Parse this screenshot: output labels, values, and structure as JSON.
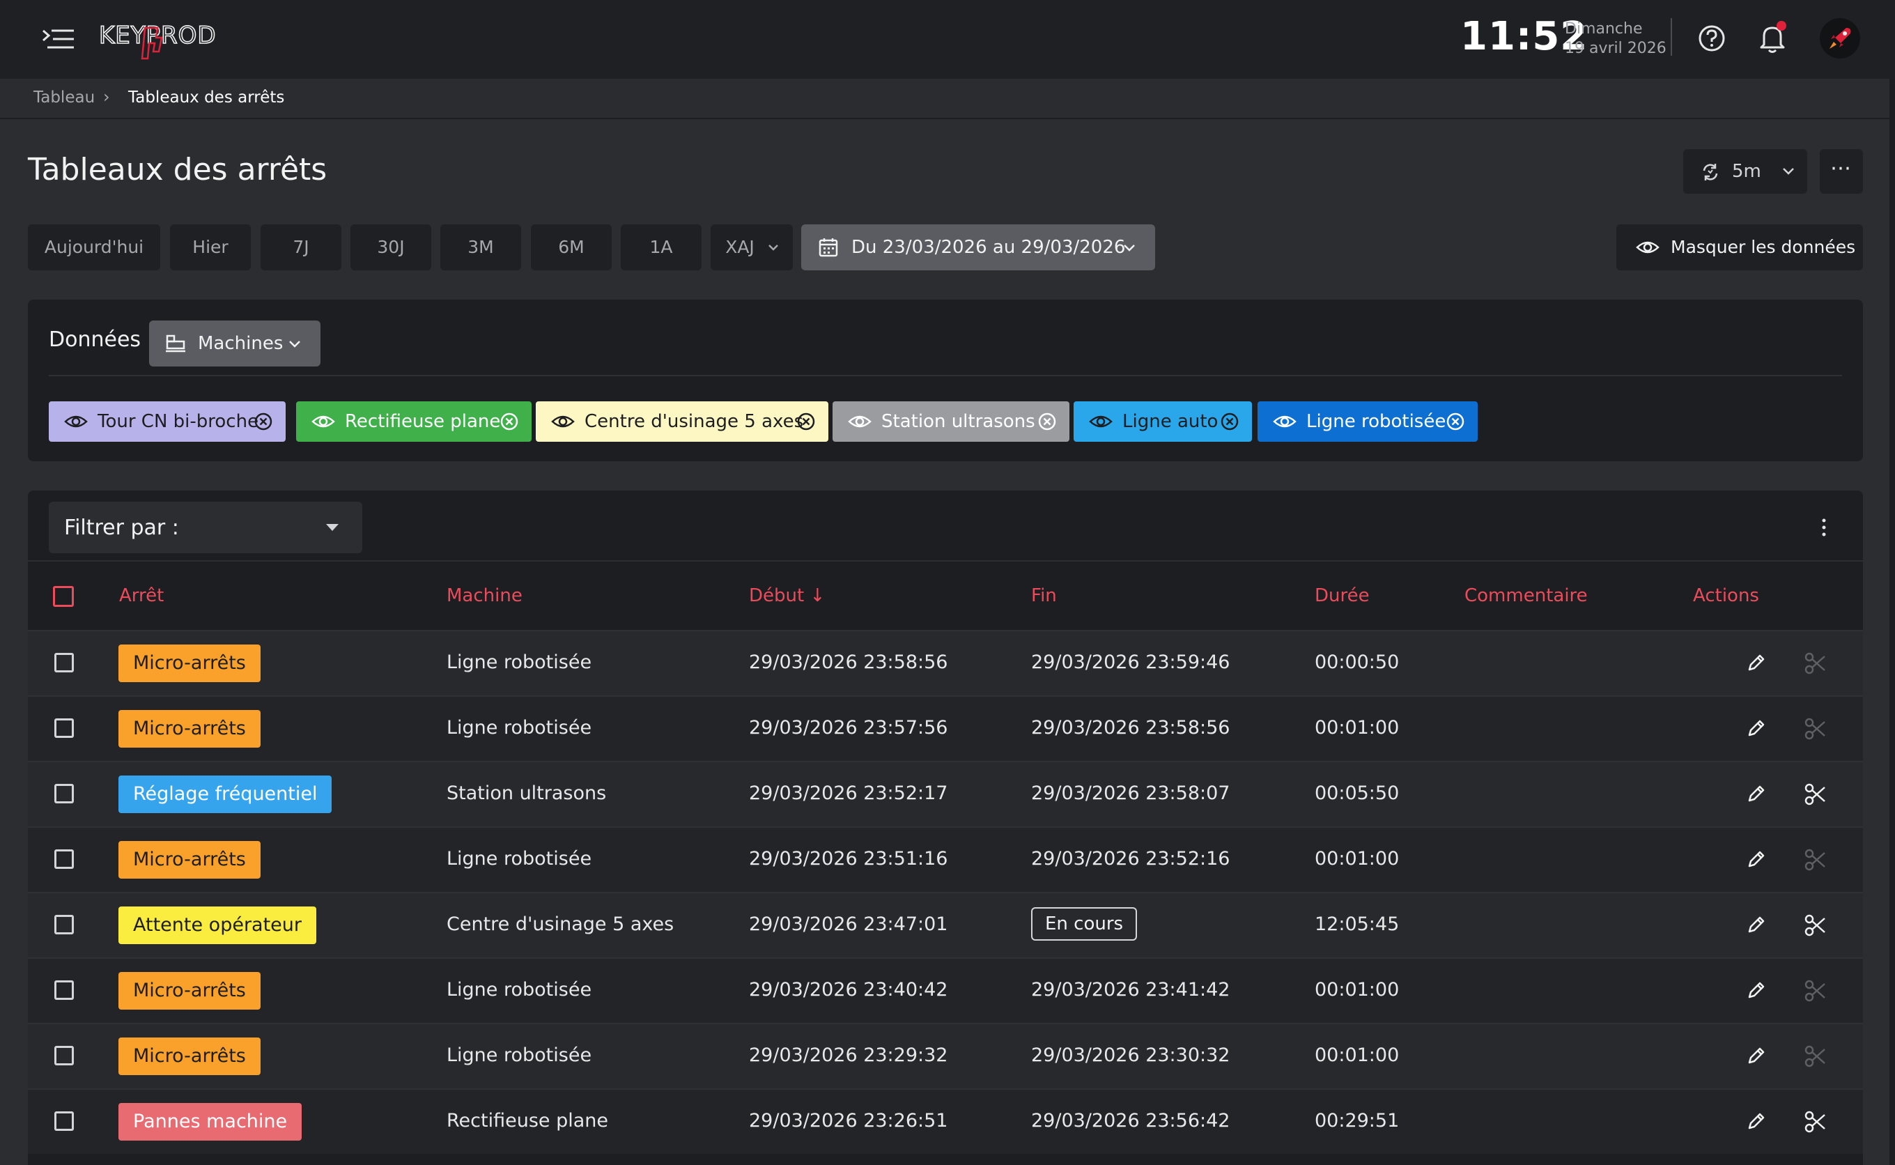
{
  "header": {
    "logo_text": "KEYPROD",
    "time": "11:52",
    "day": "Dimanche",
    "date": "19 avril 2026"
  },
  "breadcrumb": {
    "home": "Tableau",
    "separator": "›",
    "current": "Tableaux des arrêts"
  },
  "page": {
    "title": "Tableaux des arrêts",
    "refresh_label": "5m",
    "more_label": "⋯"
  },
  "period": {
    "buttons": [
      "Aujourd'hui",
      "Hier",
      "7J",
      "30J",
      "3M",
      "6M",
      "1A",
      "XAJ"
    ],
    "range_label": "Du 23/03/2026 au 29/03/2026",
    "hide_label": "Masquer les données"
  },
  "data_panel": {
    "label": "Données",
    "source_label": "Machines",
    "tags": [
      {
        "label": "Tour CN bi-broche",
        "bg": "#b7b3ea",
        "fg": "#1d1e21"
      },
      {
        "label": "Rectifieuse plane",
        "bg": "#3fb04a",
        "fg": "#ffffff"
      },
      {
        "label": "Centre d'usinage 5 axes",
        "bg": "#fdf7c4",
        "fg": "#1d1e21"
      },
      {
        "label": "Station ultrasons",
        "bg": "#9b9ca0",
        "fg": "#ffffff"
      },
      {
        "label": "Ligne auto",
        "bg": "#29a7ea",
        "fg": "#1d1e21"
      },
      {
        "label": "Ligne robotisée",
        "bg": "#0c6fd1",
        "fg": "#ffffff"
      }
    ]
  },
  "table": {
    "filter_label": "Filtrer par :",
    "columns": {
      "arret": "Arrêt",
      "machine": "Machine",
      "debut": "Début",
      "fin": "Fin",
      "duree": "Durée",
      "commentaire": "Commentaire",
      "actions": "Actions"
    },
    "sort_arrow": "↓",
    "rows": [
      {
        "arret": "Micro-arrêts",
        "badge_bg": "#f9a12a",
        "badge_fg": "#1d1e21",
        "machine": "Ligne robotisée",
        "debut": "29/03/2026 23:58:56",
        "fin": "29/03/2026 23:59:46",
        "duree": "00:00:50",
        "cut_enabled": false
      },
      {
        "arret": "Micro-arrêts",
        "badge_bg": "#f9a12a",
        "badge_fg": "#1d1e21",
        "machine": "Ligne robotisée",
        "debut": "29/03/2026 23:57:56",
        "fin": "29/03/2026 23:58:56",
        "duree": "00:01:00",
        "cut_enabled": false
      },
      {
        "arret": "Réglage fréquentiel",
        "badge_bg": "#35a4ec",
        "badge_fg": "#ffffff",
        "machine": "Station ultrasons",
        "debut": "29/03/2026 23:52:17",
        "fin": "29/03/2026 23:58:07",
        "duree": "00:05:50",
        "cut_enabled": true
      },
      {
        "arret": "Micro-arrêts",
        "badge_bg": "#f9a12a",
        "badge_fg": "#1d1e21",
        "machine": "Ligne robotisée",
        "debut": "29/03/2026 23:51:16",
        "fin": "29/03/2026 23:52:16",
        "duree": "00:01:00",
        "cut_enabled": false
      },
      {
        "arret": "Attente opérateur",
        "badge_bg": "#fbed3f",
        "badge_fg": "#1d1e21",
        "machine": "Centre d'usinage 5 axes",
        "debut": "29/03/2026 23:47:01",
        "fin": "En cours",
        "duree": "12:05:45",
        "cut_enabled": true,
        "in_progress": true
      },
      {
        "arret": "Micro-arrêts",
        "badge_bg": "#f9a12a",
        "badge_fg": "#1d1e21",
        "machine": "Ligne robotisée",
        "debut": "29/03/2026 23:40:42",
        "fin": "29/03/2026 23:41:42",
        "duree": "00:01:00",
        "cut_enabled": false
      },
      {
        "arret": "Micro-arrêts",
        "badge_bg": "#f9a12a",
        "badge_fg": "#1d1e21",
        "machine": "Ligne robotisée",
        "debut": "29/03/2026 23:29:32",
        "fin": "29/03/2026 23:30:32",
        "duree": "00:01:00",
        "cut_enabled": false
      },
      {
        "arret": "Pannes machine",
        "badge_bg": "#e86b72",
        "badge_fg": "#ffffff",
        "machine": "Rectifieuse plane",
        "debut": "29/03/2026 23:26:51",
        "fin": "29/03/2026 23:56:42",
        "duree": "00:29:51",
        "cut_enabled": true
      }
    ]
  }
}
